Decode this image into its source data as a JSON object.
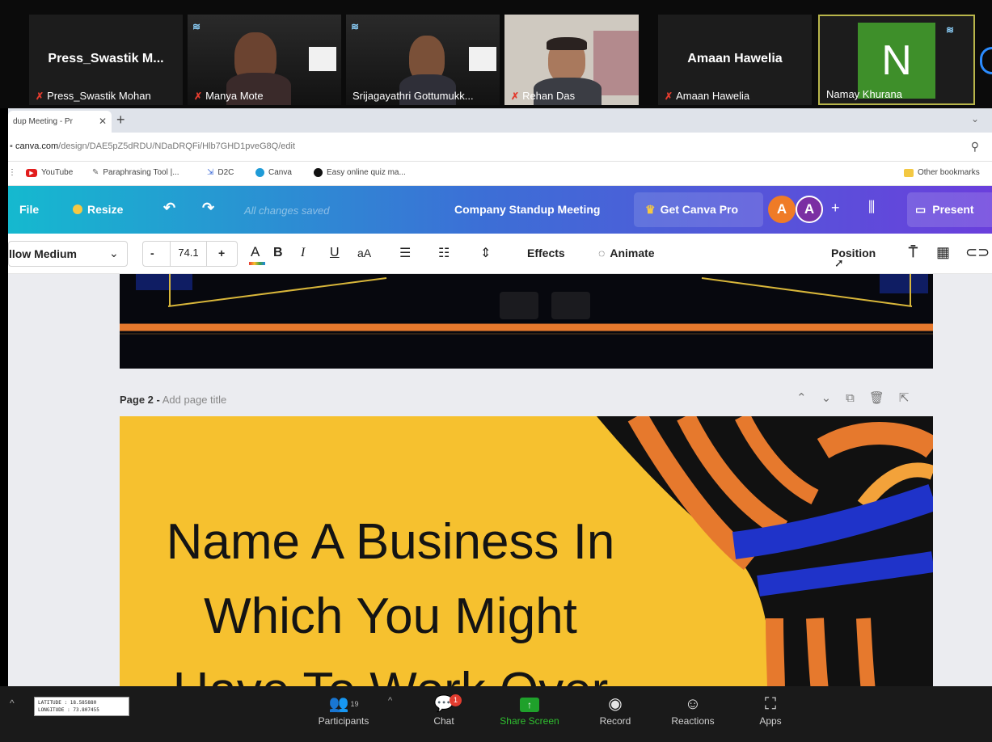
{
  "zoom": {
    "tiles": [
      {
        "display": "Press_Swastik  M...",
        "name": "Press_Swastik Mohan",
        "muted": true
      },
      {
        "name": "Manya Mote",
        "muted": true
      },
      {
        "name": "Srijagayathri Gottumukk...",
        "muted": false
      },
      {
        "name": "Rehan Das",
        "muted": true
      },
      {
        "display": "Amaan Hawelia",
        "name": "Amaan Hawelia",
        "muted": true
      },
      {
        "initial": "N",
        "name": "Namay Khurana",
        "muted": false
      }
    ],
    "toolbar": {
      "participants_label": "Participants",
      "participants_count": "19",
      "chat_label": "Chat",
      "chat_badge": "1",
      "share_label": "Share Screen",
      "record_label": "Record",
      "reactions_label": "Reactions",
      "apps_label": "Apps"
    },
    "sticker_lines": [
      "LATITUDE : 18.585880",
      "LONGITUDE : 73.807455"
    ],
    "colors": {
      "accent_green": "#2fbf2f",
      "muted_red": "#e23c2f"
    }
  },
  "browser": {
    "tab_title": "dup Meeting - Pr",
    "url_host": "canva.com",
    "url_path": "/design/DAE5pZ5dRDU/NDaDRQFi/Hlb7GHD1pveG8Q/edit",
    "bookmarks": [
      "YouTube",
      "Paraphrasing Tool |...",
      "D2C",
      "Canva",
      "Easy online quiz ma..."
    ],
    "other_bookmarks": "Other bookmarks"
  },
  "canva": {
    "header": {
      "file": "File",
      "resize": "Resize",
      "saved_status": "All changes saved",
      "doc_title": "Company Standup Meeting",
      "get_pro": "Get Canva Pro",
      "avatars": [
        "A",
        "A"
      ],
      "present": "Present"
    },
    "toolbar": {
      "font_name": "llow Medium",
      "font_size": "74.1",
      "minus": "-",
      "plus": "+",
      "case_label": "aA",
      "effects": "Effects",
      "animate": "Animate",
      "position": "Position"
    },
    "page2": {
      "label": "Page 2 -",
      "title_hint": "Add page title",
      "slide_lines": [
        "Name A Business In",
        "Which You Might",
        "Have To Work Over"
      ]
    },
    "colors": {
      "slide_yellow": "#f6c12f",
      "stripe_orange": "#e6792d",
      "stripe_blue": "#1f33c9"
    }
  }
}
